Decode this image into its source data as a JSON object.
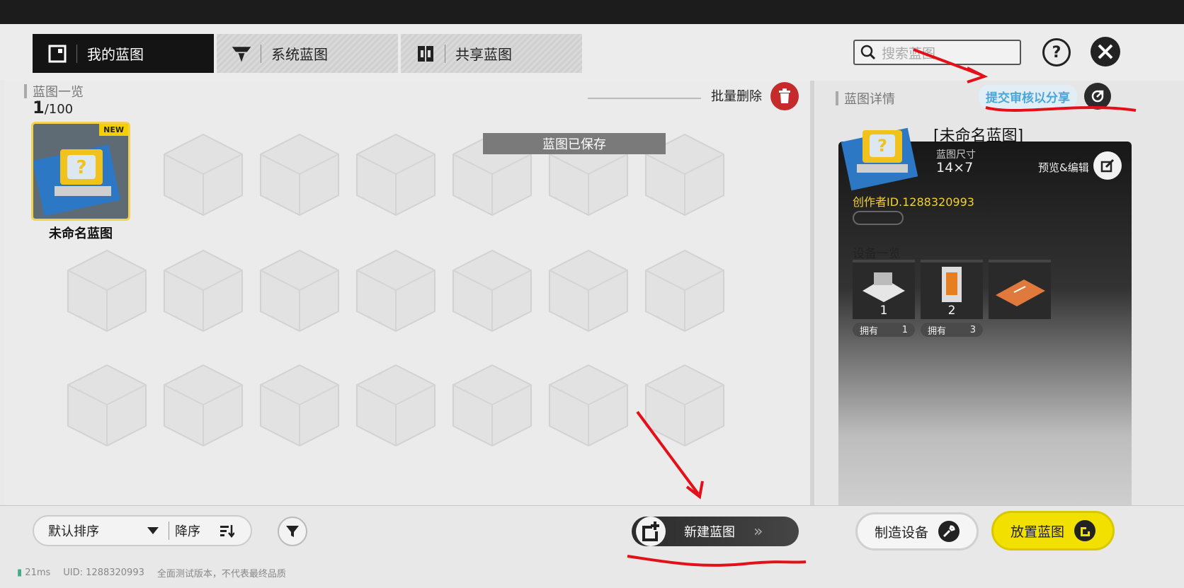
{
  "tabs": [
    {
      "label": "我的蓝图",
      "active": true
    },
    {
      "label": "系统蓝图",
      "active": false
    },
    {
      "label": "共享蓝图",
      "active": false
    }
  ],
  "search": {
    "placeholder": "搜索蓝图"
  },
  "left": {
    "title": "蓝图一览",
    "count_current": "1",
    "count_total": "/100",
    "batch_delete": "批量删除",
    "card": {
      "badge": "NEW",
      "name": "未命名蓝图"
    },
    "toast": "蓝图已保存"
  },
  "right": {
    "title": "蓝图详情",
    "submit": "提交审核以分享",
    "name": "未命名蓝图",
    "size_label": "蓝图尺寸",
    "size_value": "14×7",
    "preview_edit": "预览&编辑",
    "author": "创作者ID.1288320993",
    "devices_title": "设备一览",
    "devices": [
      {
        "num": "1",
        "own_label": "拥有",
        "own_count": "1"
      },
      {
        "num": "2",
        "own_label": "拥有",
        "own_count": "3"
      },
      {
        "num": "",
        "own_label": "",
        "own_count": ""
      }
    ]
  },
  "bottom": {
    "sort": "默认排序",
    "order": "降序",
    "new_blueprint": "新建蓝图",
    "make_device": "制造设备",
    "place_blueprint": "放置蓝图"
  },
  "footer": {
    "ping": "21ms",
    "uid": "UID: 1288320993",
    "notice": "全面测试版本，不代表最终品质"
  },
  "colors": {
    "accent_yellow": "#f2e100",
    "danger": "#c62b2b",
    "link_blue": "#4ba6d8"
  }
}
